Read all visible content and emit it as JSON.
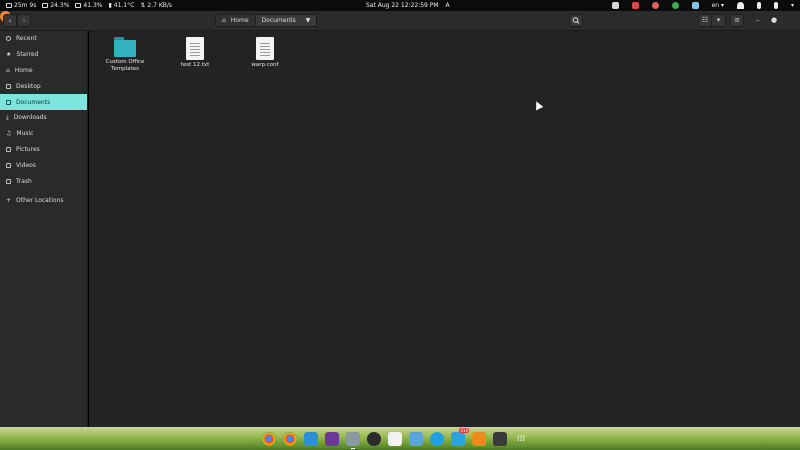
{
  "topbar": {
    "timer": "25m 9s",
    "cpu": "24.3%",
    "memory": "41.3%",
    "temperature": "41.1°C",
    "network": "2.7 KB/s",
    "clock": "Sat Aug 22  12:22:59 PM",
    "language": "en"
  },
  "header": {
    "breadcrumb_home": "Home",
    "breadcrumb_current": "Documents"
  },
  "sidebar": {
    "items": [
      {
        "label": "Recent"
      },
      {
        "label": "Starred"
      },
      {
        "label": "Home"
      },
      {
        "label": "Desktop"
      },
      {
        "label": "Documents"
      },
      {
        "label": "Downloads"
      },
      {
        "label": "Music"
      },
      {
        "label": "Pictures"
      },
      {
        "label": "Videos"
      },
      {
        "label": "Trash"
      },
      {
        "label": "Other Locations"
      }
    ],
    "active": "Documents"
  },
  "files": [
    {
      "name": "Custom Office Templates",
      "type": "folder"
    },
    {
      "name": "test 12.txt",
      "type": "text"
    },
    {
      "name": "warp.conf",
      "type": "text"
    }
  ],
  "dock": {
    "apps": [
      "chrome",
      "chrome-alt",
      "vscode",
      "notes",
      "files",
      "headphones",
      "text-editor",
      "installer",
      "skype",
      "telegram",
      "vlc",
      "terminal",
      "app-grid"
    ],
    "telegram_badge": "410"
  },
  "colors": {
    "accent": "#7ce6dc",
    "folder": "#35b2bf",
    "window_close": "#e68a2a"
  }
}
